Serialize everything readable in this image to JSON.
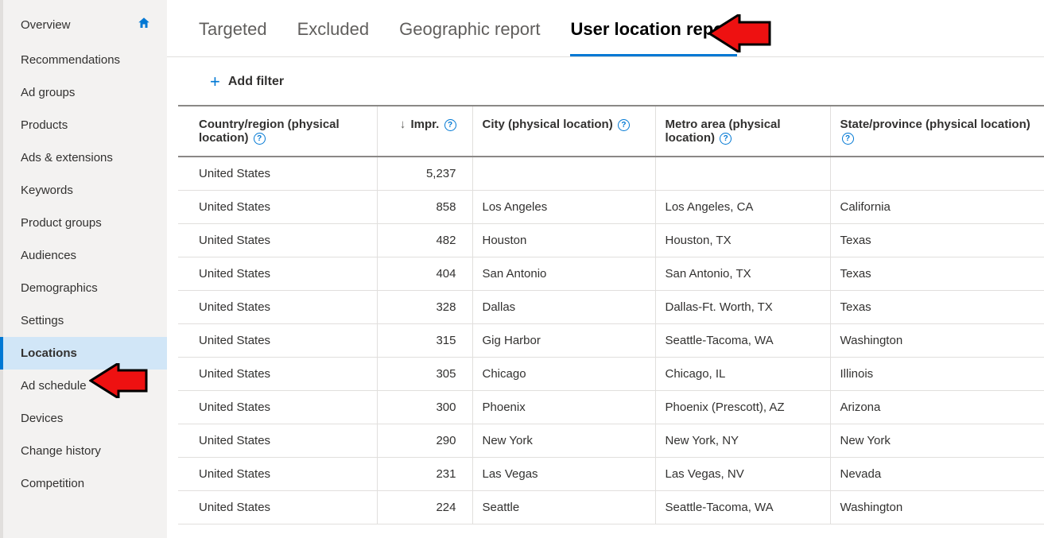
{
  "sidebar": {
    "items": [
      {
        "label": "Overview",
        "home": true
      },
      {
        "label": "Recommendations"
      },
      {
        "label": "Ad groups"
      },
      {
        "label": "Products"
      },
      {
        "label": "Ads & extensions"
      },
      {
        "label": "Keywords"
      },
      {
        "label": "Product groups"
      },
      {
        "label": "Audiences"
      },
      {
        "label": "Demographics"
      },
      {
        "label": "Settings"
      },
      {
        "label": "Locations",
        "active": true
      },
      {
        "label": "Ad schedule"
      },
      {
        "label": "Devices"
      },
      {
        "label": "Change history"
      },
      {
        "label": "Competition"
      }
    ]
  },
  "tabs": [
    {
      "label": "Targeted"
    },
    {
      "label": "Excluded"
    },
    {
      "label": "Geographic report"
    },
    {
      "label": "User location report",
      "active": true
    }
  ],
  "filter": {
    "add_label": "Add filter"
  },
  "table": {
    "columns": {
      "country": "Country/region (physical location)",
      "impr": "Impr.",
      "city": "City (physical location)",
      "metro": "Metro area (physical location)",
      "state": "State/province (physical location)"
    },
    "rows": [
      {
        "country": "United States",
        "impr": "5,237",
        "city": "",
        "metro": "",
        "state": ""
      },
      {
        "country": "United States",
        "impr": "858",
        "city": "Los Angeles",
        "metro": "Los Angeles, CA",
        "state": "California"
      },
      {
        "country": "United States",
        "impr": "482",
        "city": "Houston",
        "metro": "Houston, TX",
        "state": "Texas"
      },
      {
        "country": "United States",
        "impr": "404",
        "city": "San Antonio",
        "metro": "San Antonio, TX",
        "state": "Texas"
      },
      {
        "country": "United States",
        "impr": "328",
        "city": "Dallas",
        "metro": "Dallas-Ft. Worth, TX",
        "state": "Texas"
      },
      {
        "country": "United States",
        "impr": "315",
        "city": "Gig Harbor",
        "metro": "Seattle-Tacoma, WA",
        "state": "Washington"
      },
      {
        "country": "United States",
        "impr": "305",
        "city": "Chicago",
        "metro": "Chicago, IL",
        "state": "Illinois"
      },
      {
        "country": "United States",
        "impr": "300",
        "city": "Phoenix",
        "metro": "Phoenix (Prescott), AZ",
        "state": "Arizona"
      },
      {
        "country": "United States",
        "impr": "290",
        "city": "New York",
        "metro": "New York, NY",
        "state": "New York"
      },
      {
        "country": "United States",
        "impr": "231",
        "city": "Las Vegas",
        "metro": "Las Vegas, NV",
        "state": "Nevada"
      },
      {
        "country": "United States",
        "impr": "224",
        "city": "Seattle",
        "metro": "Seattle-Tacoma, WA",
        "state": "Washington"
      }
    ]
  }
}
